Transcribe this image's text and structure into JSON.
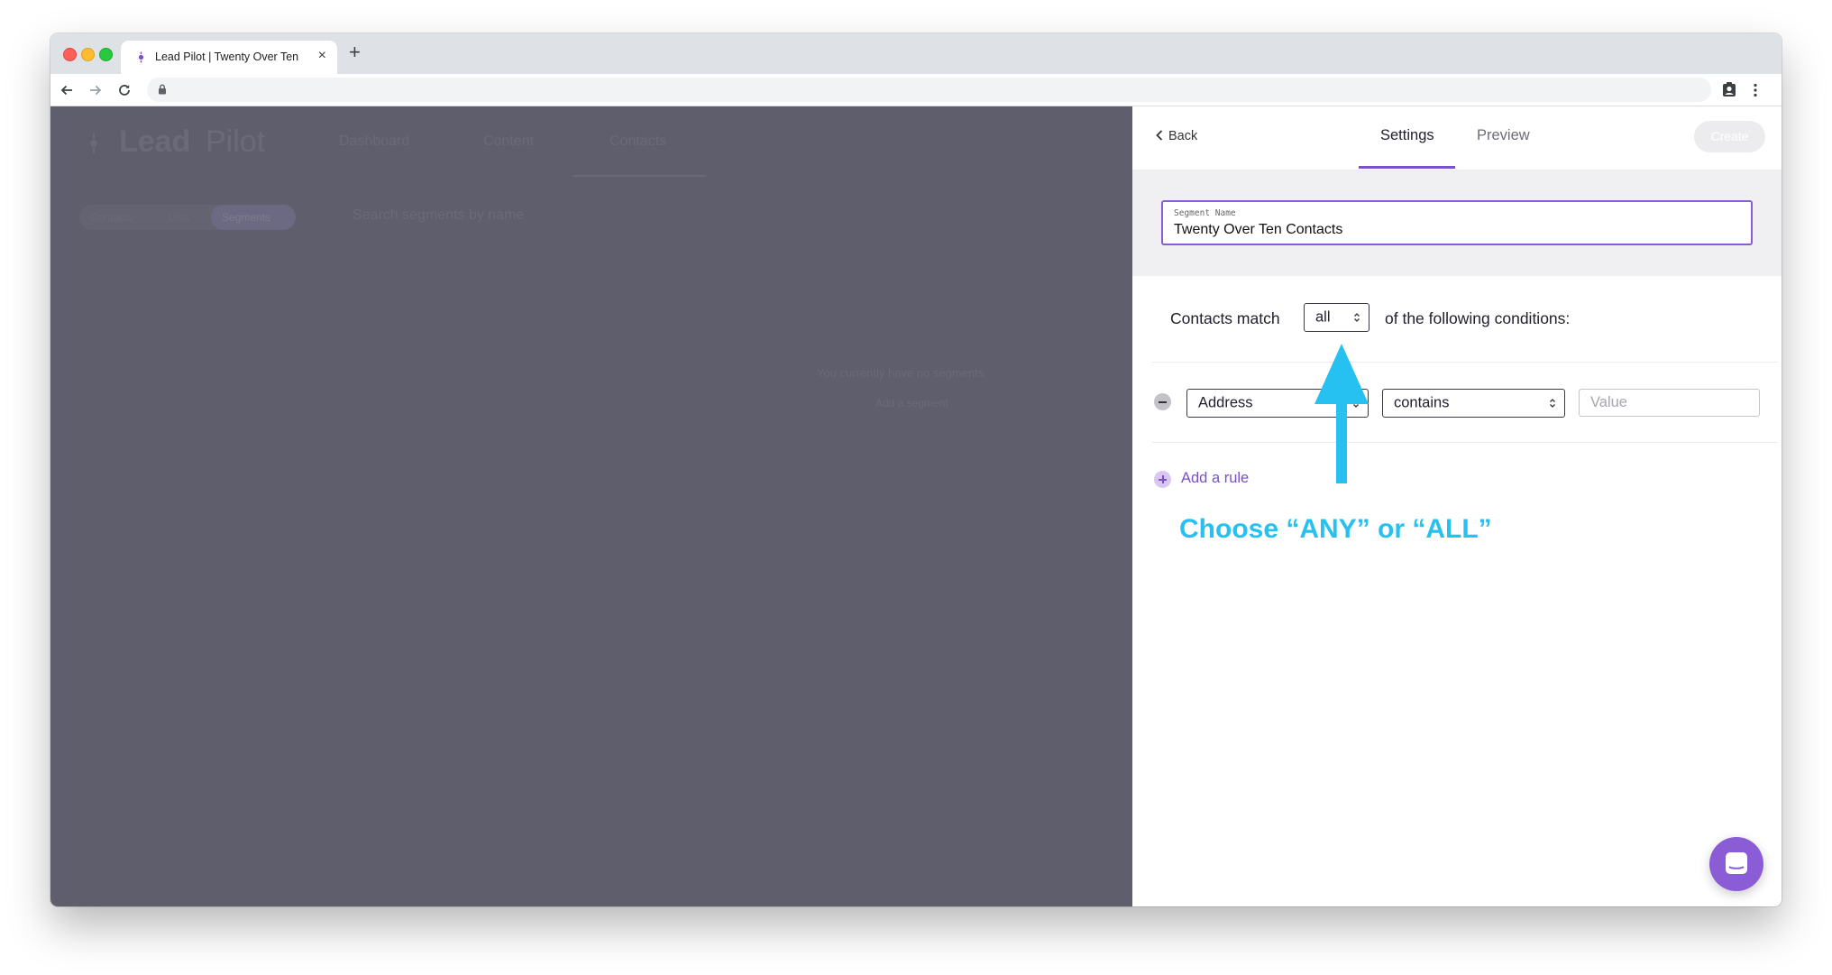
{
  "browser": {
    "tab_title": "Lead Pilot | Twenty Over Ten",
    "tab_close": "×",
    "new_tab": "+"
  },
  "background_app": {
    "logo_bold": "Lead",
    "logo_light": "Pilot",
    "nav": [
      "Dashboard",
      "Content",
      "Contacts"
    ],
    "subnav": [
      "Contacts",
      "Lists",
      "Segments"
    ],
    "search_placeholder": "Search segments by name",
    "empty_message": "You currently have no segments",
    "empty_button": "Add a segment"
  },
  "panel": {
    "back_label": "Back",
    "tabs": [
      "Settings",
      "Preview"
    ],
    "active_tab": "Settings",
    "create_label": "Create",
    "segment_name_label": "Segment Name",
    "segment_name_value": "Twenty Over Ten Contacts",
    "match_prefix": "Contacts match",
    "match_value": "all",
    "match_suffix": "of the following conditions:",
    "rule": {
      "field": "Address",
      "operator": "contains",
      "value_placeholder": "Value"
    },
    "add_rule_label": "Add a rule"
  },
  "annotation": {
    "text": "Choose “ANY” or “ALL”",
    "color": "#27c1f1"
  },
  "colors": {
    "accent": "#7b50c9",
    "overlay": "#5f5e6c"
  },
  "icons": [
    "back-arrow-icon",
    "forward-arrow-icon",
    "reload-icon",
    "lock-icon",
    "profile-icon",
    "menu-dots-icon",
    "chevron-left-icon",
    "select-chevrons-icon",
    "remove-rule-icon",
    "add-rule-icon",
    "chat-icon"
  ]
}
